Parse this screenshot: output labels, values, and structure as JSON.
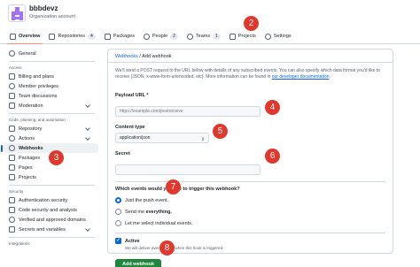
{
  "header": {
    "org_name": "bbbdevz",
    "org_type": "Organization account",
    "tabs": [
      {
        "label": "Overview",
        "icon": "home-icon",
        "count": ""
      },
      {
        "label": "Repositories",
        "icon": "repo-icon",
        "count": "4"
      },
      {
        "label": "Packages",
        "icon": "package-icon",
        "count": ""
      },
      {
        "label": "People",
        "icon": "person-icon",
        "count": "2"
      },
      {
        "label": "Teams",
        "icon": "people-icon",
        "count": "1"
      },
      {
        "label": "Projects",
        "icon": "table-icon",
        "count": ""
      },
      {
        "label": "Settings",
        "icon": "gear-icon",
        "count": ""
      }
    ]
  },
  "sidebar": {
    "general": "General",
    "access_section": "Access",
    "billing": "Billing and plans",
    "member_privileges": "Member privileges",
    "team_discussions": "Team discussions",
    "moderation": "Moderation",
    "code_section": "Code, planning, and automation",
    "repository": "Repository",
    "actions": "Actions",
    "webhooks": "Webhooks",
    "packages": "Packages",
    "pages": "Pages",
    "projects": "Projects",
    "security_section": "Security",
    "auth_security": "Authentication security",
    "code_security": "Code security and analysis",
    "verified_domains": "Verified and approved domains",
    "secrets_variables": "Secrets and variables",
    "integrations_section": "Integrations"
  },
  "main": {
    "breadcrumb_link": "Webhooks",
    "breadcrumb_current": " / Add webhook",
    "intro_text": "We'll send a POST request to the URL below with details of any subscribed events. You can also specify which data format you'd like to receive (JSON, x-www-form-urlencoded, etc). More information can be found in ",
    "intro_link": "our developer documentation",
    "intro_end": ".",
    "payload_label": "Payload URL *",
    "payload_placeholder": "https://example.com/postreceive",
    "content_type_label": "Content type",
    "content_type_value": "application/json",
    "secret_label": "Secret",
    "events_question": "Which events would you like to trigger this webhook?",
    "radio_push": "Just the push event.",
    "radio_everything_prefix": "Send me ",
    "radio_everything_bold": "everything.",
    "radio_individual": "Let me select individual events.",
    "active_label": "Active",
    "active_desc": "We will deliver event details when this hook is triggered.",
    "add_button": "Add webhook"
  },
  "badges": [
    "2",
    "3",
    "4",
    "5",
    "6",
    "7",
    "8"
  ]
}
